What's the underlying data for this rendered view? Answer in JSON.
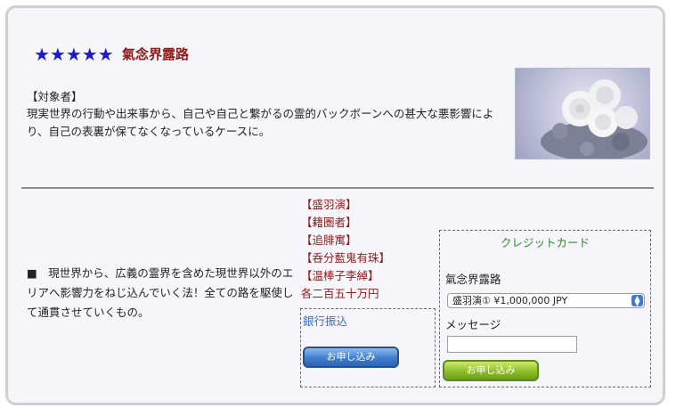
{
  "header": {
    "stars": "★★★★★",
    "title": "氣念界露路"
  },
  "intro": {
    "target_heading": "【対象者】",
    "description": "現実世界の行動や出来事から、自己や自己と繋がるの霊的バックボーンへの甚大な悪影響により、自己の表裏が保てなくなっているケースに。"
  },
  "photo": {
    "icon": "white-roses-photo"
  },
  "main": {
    "text": "■　現世界から、広義の霊界を含めた現世界以外のエリアへ影響力をねじ込んでいく法！全ての路を駆使して通貫させていくもの。"
  },
  "prices": {
    "items": [
      "【盛羽演】",
      "【籍圏者】",
      "【追腓寓】",
      "【呑分藍鬼有珠】",
      "【温棒子李綽】"
    ],
    "total": "各二百五十万円"
  },
  "bank": {
    "label": "銀行振込",
    "button": "お申し込み"
  },
  "card": {
    "title": "クレジットカード",
    "product": "氣念界露路",
    "select_value": "盛羽演① ¥1,000,000 JPY",
    "message_label": "メッセージ",
    "message_value": "",
    "button": "お申し込み"
  },
  "colors": {
    "stars": "#1a1ad6",
    "title": "#8b1a1a",
    "card_title": "#2f8a2f",
    "bank_label": "#3c6fb5"
  }
}
